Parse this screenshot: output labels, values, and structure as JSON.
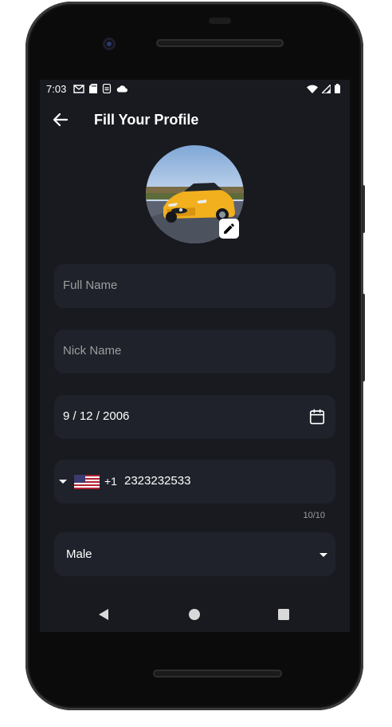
{
  "status_bar": {
    "time": "7:03",
    "left_icons": [
      "gmail-icon",
      "sd-card-icon",
      "sync-icon",
      "cloud-icon"
    ],
    "right_icons": [
      "wifi-icon",
      "cellular-signal-icon",
      "battery-icon"
    ]
  },
  "app_bar": {
    "title": "Fill Your Profile",
    "back_icon": "arrow-left-icon"
  },
  "profile": {
    "avatar_description": "yellow sports car",
    "edit_icon": "pencil-icon"
  },
  "form": {
    "full_name": {
      "placeholder": "Full Name",
      "value": ""
    },
    "nick_name": {
      "placeholder": "Nick Name",
      "value": ""
    },
    "date_of_birth": {
      "value": "9 / 12 / 2006",
      "icon": "calendar-icon"
    },
    "phone": {
      "country_flag": "us-flag-icon",
      "dial_code": "+1",
      "number": "2323232533",
      "counter": "10/10"
    },
    "gender": {
      "value": "Male",
      "icon": "dropdown-arrow-icon"
    }
  },
  "nav_bar": {
    "items": [
      "back-triangle-icon",
      "home-circle-icon",
      "recents-square-icon"
    ]
  },
  "colors": {
    "background": "#181a20",
    "field_background": "#1f222a",
    "placeholder": "#9e9e9e",
    "text": "#ffffff"
  }
}
